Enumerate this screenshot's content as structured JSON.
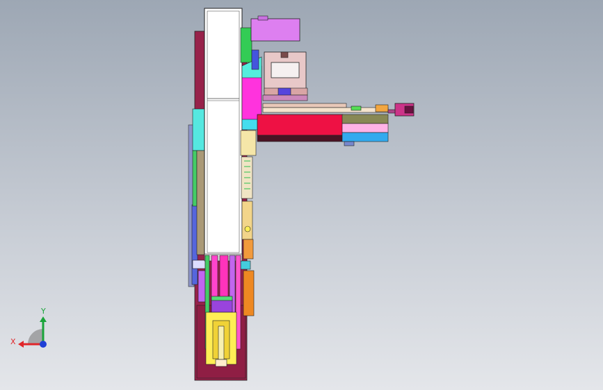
{
  "view": {
    "background_top": "#9da7b4",
    "background_bottom": "#e4e6ea"
  },
  "triad": {
    "x_label": "X",
    "y_label": "Y",
    "x_color": "#e0262a",
    "y_color": "#1aa43a",
    "z_color": "#1f3fd6"
  },
  "colors": {
    "maroon": "#97224a",
    "magenta": "#ff33cc",
    "violet": "#dd7ff0",
    "green": "#33cc55",
    "blue": "#5566dd",
    "cyan": "#44dddd",
    "red": "#ee1144",
    "olive": "#888855",
    "pink": "#ffb3e6",
    "sky": "#33aaee",
    "orange": "#ee8822",
    "yellow": "#ffee55",
    "white": "#ffffff"
  }
}
